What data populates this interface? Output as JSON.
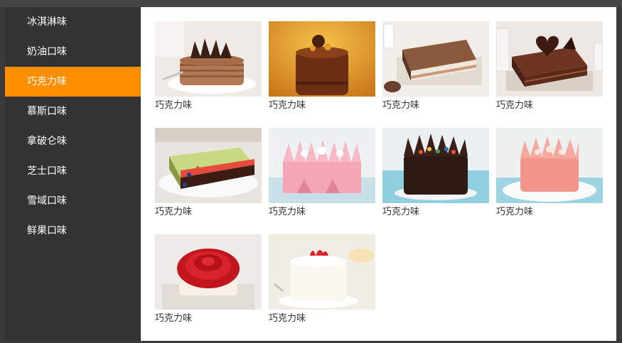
{
  "sidebar": {
    "items": [
      {
        "label": "冰淇淋味"
      },
      {
        "label": "奶油口味"
      },
      {
        "label": "巧克力味"
      },
      {
        "label": "慕斯口味"
      },
      {
        "label": "拿破仑味"
      },
      {
        "label": "芝士口味"
      },
      {
        "label": "雪域口味"
      },
      {
        "label": "鲜果口味"
      }
    ],
    "active_label": "巧克力味",
    "active_color": "#ff8f00"
  },
  "products": [
    {
      "caption": "巧克力味",
      "image": "chocolate-crepe-cake-photo"
    },
    {
      "caption": "巧克力味",
      "image": "chocolate-dome-cake-photo"
    },
    {
      "caption": "巧克力味",
      "image": "layered-tiramisu-cake-photo"
    },
    {
      "caption": "巧克力味",
      "image": "chocolate-heart-layer-cake-photo"
    },
    {
      "caption": "巧克力味",
      "image": "berry-chocolate-napoleon-photo"
    },
    {
      "caption": "巧克力味",
      "image": "pink-mousse-cake-photo"
    },
    {
      "caption": "巧克力味",
      "image": "dark-chocolate-crown-cake-photo"
    },
    {
      "caption": "巧克力味",
      "image": "peach-crown-cake-photo"
    },
    {
      "caption": "巧克力味",
      "image": "red-rose-cake-photo"
    },
    {
      "caption": "巧克力味",
      "image": "strawberry-cream-cake-photo"
    }
  ]
}
